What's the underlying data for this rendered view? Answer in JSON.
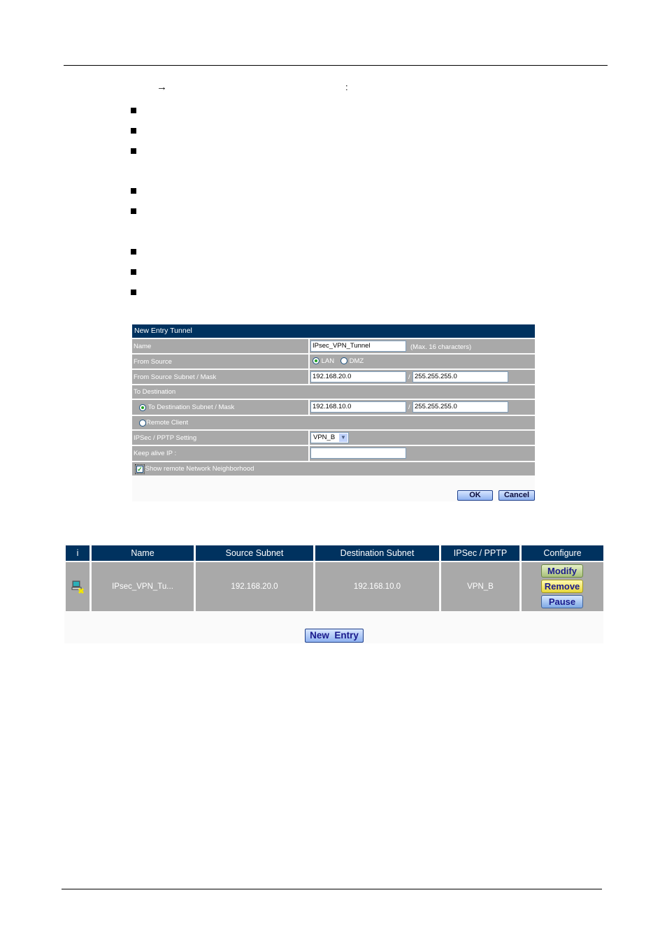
{
  "document": {
    "arrow_glyph": "→",
    "colon": ":",
    "bullet_count": 8
  },
  "form": {
    "title": "New Entry Tunnel",
    "name_label": "Name",
    "name_value": "IPsec_VPN_Tunnel",
    "name_note": "(Max. 16 characters)",
    "from_source_label": "From Source",
    "source_options": [
      {
        "label": "LAN",
        "selected": true
      },
      {
        "label": "DMZ",
        "selected": false
      }
    ],
    "source_subnet_label": "From Source Subnet / Mask",
    "source_subnet": "192.168.20.0",
    "source_mask": "255.255.255.0",
    "slash": "/",
    "to_destination_label": "To Destination",
    "dest_subnet_label": "To Destination Subnet / Mask",
    "dest_subnet": "192.168.10.0",
    "dest_mask": "255.255.255.0",
    "remote_client_label": "Remote Client",
    "ipsec_label": "IPSec / PPTP Setting",
    "ipsec_value": "VPN_B",
    "keepalive_label": "Keep alive IP :",
    "keepalive_value": "",
    "show_neighborhood_label": "Show remote Network Neighborhood",
    "show_neighborhood_checked": true,
    "ok_label": "OK",
    "cancel_label": "Cancel"
  },
  "table": {
    "headers": [
      "i",
      "Name",
      "Source Subnet",
      "Destination Subnet",
      "IPSec / PPTP",
      "Configure"
    ],
    "rows": [
      {
        "icon": "computer-disconnected-icon",
        "name": "IPsec_VPN_Tu...",
        "source_subnet": "192.168.20.0",
        "destination_subnet": "192.168.10.0",
        "ipsec_pptp": "VPN_B",
        "actions": [
          "Modify",
          "Remove",
          "Pause"
        ]
      }
    ],
    "new_entry_label": "New  Entry"
  },
  "colors": {
    "header_navy": "#00325f",
    "cell_gray": "#a9a9a9"
  }
}
